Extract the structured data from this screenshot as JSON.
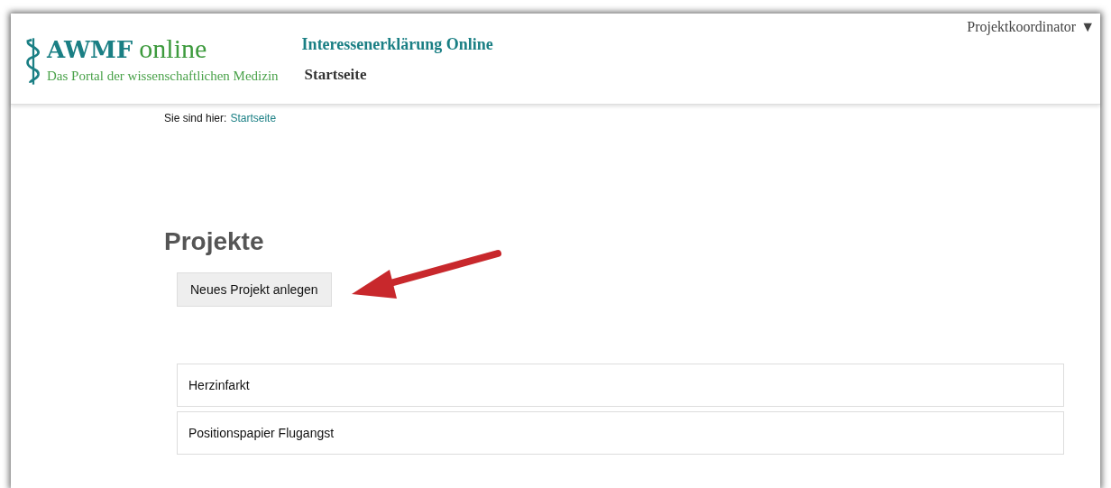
{
  "header": {
    "logo": {
      "brand": "AWMF",
      "brand_suffix": "online",
      "tagline": "Das Portal der wissenschaftlichen Medizin"
    },
    "app_title": "Interessenerklärung Online",
    "current_page": "Startseite",
    "user_menu": {
      "label": "Projektkoordinator",
      "caret": "▼"
    }
  },
  "breadcrumb": {
    "label": "Sie sind hier:",
    "link": "Startseite"
  },
  "heading": "Projekte",
  "new_project_button": "Neues Projekt anlegen",
  "projects": [
    {
      "name": "Herzinfarkt"
    },
    {
      "name": "Positionspapier Flugangst"
    }
  ]
}
